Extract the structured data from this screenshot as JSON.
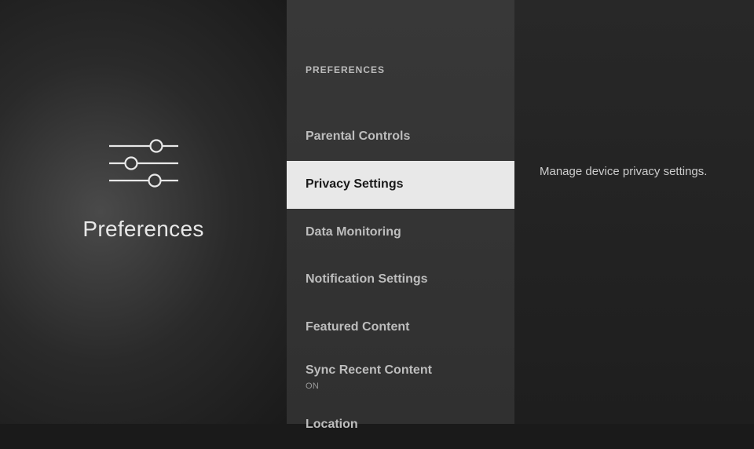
{
  "left": {
    "title": "Preferences"
  },
  "section_header": "PREFERENCES",
  "menu": [
    {
      "label": "Parental Controls",
      "sub": "",
      "selected": false
    },
    {
      "label": "Privacy Settings",
      "sub": "",
      "selected": true
    },
    {
      "label": "Data Monitoring",
      "sub": "",
      "selected": false
    },
    {
      "label": "Notification Settings",
      "sub": "",
      "selected": false
    },
    {
      "label": "Featured Content",
      "sub": "",
      "selected": false
    },
    {
      "label": "Sync Recent Content",
      "sub": "ON",
      "selected": false
    },
    {
      "label": "Location",
      "sub": "",
      "selected": false
    }
  ],
  "description": "Manage device privacy settings."
}
